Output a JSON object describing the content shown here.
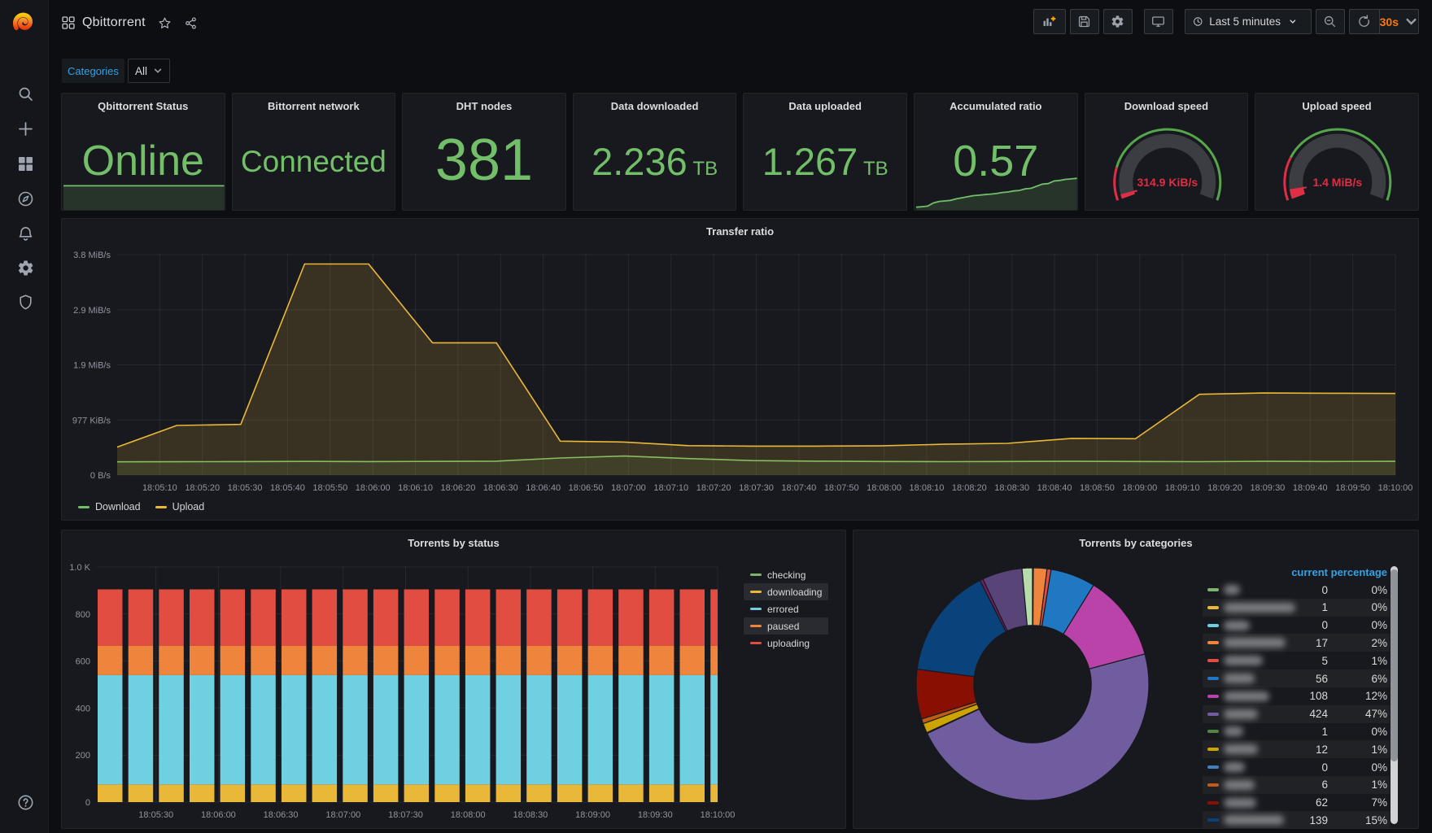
{
  "header": {
    "title": "Qbittorrent",
    "toolbar": {
      "time_range": "Last 5 minutes",
      "refresh_interval": "30s"
    }
  },
  "variables": {
    "label": "Categories",
    "value": "All"
  },
  "sidebar": {
    "icons": [
      "search-icon",
      "plus-icon",
      "dashboards-icon",
      "explore-compass-icon",
      "alerting-bell-icon",
      "configuration-gear-icon",
      "server-admin-shield-icon"
    ],
    "bottom_icons": [
      "help-icon"
    ]
  },
  "chart_data": [
    {
      "id": "stats",
      "type": "stat-row",
      "panels": [
        {
          "title": "Qbittorrent Status",
          "value": "Online",
          "color": "#73BF69",
          "font": 52,
          "sparkline": {
            "values": [
              1,
              1
            ],
            "max": 1.45
          }
        },
        {
          "title": "Bittorrent network",
          "value": "Connected",
          "color": "#73BF69",
          "font": 37
        },
        {
          "title": "DHT nodes",
          "value": "381",
          "color": "#73BF69",
          "font": 72
        },
        {
          "title": "Data downloaded",
          "value": "2.236",
          "unit": "TB",
          "color": "#73BF69",
          "font": 47
        },
        {
          "title": "Data uploaded",
          "value": "1.267",
          "unit": "TB",
          "color": "#73BF69",
          "font": 47
        },
        {
          "title": "Accumulated ratio",
          "value": "0.57",
          "color": "#73BF69",
          "font": 54,
          "sparkline": {
            "values": [
              0.02,
              0.03,
              0.04,
              0.1,
              0.13,
              0.14,
              0.15,
              0.18,
              0.2,
              0.22,
              0.24,
              0.25,
              0.26,
              0.27,
              0.28,
              0.3,
              0.31,
              0.33,
              0.34,
              0.37,
              0.38,
              0.42,
              0.46,
              0.47,
              0.52,
              0.53,
              0.55,
              0.56,
              0.57
            ],
            "max": 0.62
          }
        }
      ]
    },
    {
      "id": "gauges",
      "type": "gauge-row",
      "panels": [
        {
          "title": "Download speed",
          "value": "314.9 KiB/s",
          "fraction": 0.02,
          "threshold_red": 0.165
        },
        {
          "title": "Upload speed",
          "value": "1.4 MiB/s",
          "fraction": 0.048,
          "threshold_red": 0.218
        }
      ],
      "colors": {
        "green": "#56A64B",
        "red": "#E02F44",
        "track": "#3b3d42",
        "text": "#e8384f"
      }
    },
    {
      "id": "transfer",
      "type": "line",
      "title": "Transfer ratio",
      "xlabel": "",
      "ylabel": "",
      "x_range_seconds": [
        0,
        300
      ],
      "x_ticks": [
        {
          "t": 10,
          "label": "18:05:10"
        },
        {
          "t": 20,
          "label": "18:05:20"
        },
        {
          "t": 30,
          "label": "18:05:30"
        },
        {
          "t": 40,
          "label": "18:05:40"
        },
        {
          "t": 50,
          "label": "18:05:50"
        },
        {
          "t": 60,
          "label": "18:06:00"
        },
        {
          "t": 70,
          "label": "18:06:10"
        },
        {
          "t": 80,
          "label": "18:06:20"
        },
        {
          "t": 90,
          "label": "18:06:30"
        },
        {
          "t": 100,
          "label": "18:06:40"
        },
        {
          "t": 110,
          "label": "18:06:50"
        },
        {
          "t": 120,
          "label": "18:07:00"
        },
        {
          "t": 130,
          "label": "18:07:10"
        },
        {
          "t": 140,
          "label": "18:07:20"
        },
        {
          "t": 150,
          "label": "18:07:30"
        },
        {
          "t": 160,
          "label": "18:07:40"
        },
        {
          "t": 170,
          "label": "18:07:50"
        },
        {
          "t": 180,
          "label": "18:08:00"
        },
        {
          "t": 190,
          "label": "18:08:10"
        },
        {
          "t": 200,
          "label": "18:08:20"
        },
        {
          "t": 210,
          "label": "18:08:30"
        },
        {
          "t": 220,
          "label": "18:08:40"
        },
        {
          "t": 230,
          "label": "18:08:50"
        },
        {
          "t": 240,
          "label": "18:09:00"
        },
        {
          "t": 250,
          "label": "18:09:10"
        },
        {
          "t": 260,
          "label": "18:09:20"
        },
        {
          "t": 270,
          "label": "18:09:30"
        },
        {
          "t": 280,
          "label": "18:09:40"
        },
        {
          "t": 290,
          "label": "18:09:50"
        },
        {
          "t": 300,
          "label": "18:10:00"
        }
      ],
      "y_max": 4000000,
      "y_ticks": [
        {
          "v": 0,
          "label": "0 B/s"
        },
        {
          "v": 1000000,
          "label": "977 KiB/s"
        },
        {
          "v": 2000000,
          "label": "1.9 MiB/s"
        },
        {
          "v": 3000000,
          "label": "2.9 MiB/s"
        },
        {
          "v": 4000000,
          "label": "3.8 MiB/s"
        }
      ],
      "series": [
        {
          "name": "Download",
          "color": "#73BF69",
          "fill_opacity": 0.1,
          "points": [
            [
              -1,
              240000
            ],
            [
              14,
              242000
            ],
            [
              29,
              245000
            ],
            [
              44,
              248000
            ],
            [
              59,
              245000
            ],
            [
              74,
              248000
            ],
            [
              89,
              252000
            ],
            [
              104,
              310000
            ],
            [
              119,
              345000
            ],
            [
              134,
              300000
            ],
            [
              149,
              262000
            ],
            [
              164,
              252000
            ],
            [
              179,
              246000
            ],
            [
              194,
              244000
            ],
            [
              209,
              247000
            ],
            [
              224,
              250000
            ],
            [
              239,
              246000
            ],
            [
              254,
              244000
            ],
            [
              269,
              250000
            ],
            [
              284,
              247000
            ],
            [
              301,
              250000
            ]
          ]
        },
        {
          "name": "Upload",
          "color": "#EAB839",
          "fill_opacity": 0.16,
          "points": [
            [
              -1,
              480000
            ],
            [
              14,
              900000
            ],
            [
              29,
              920000
            ],
            [
              44,
              3830000
            ],
            [
              59,
              3830000
            ],
            [
              74,
              2400000
            ],
            [
              89,
              2400000
            ],
            [
              104,
              615000
            ],
            [
              119,
              600000
            ],
            [
              134,
              535000
            ],
            [
              149,
              525000
            ],
            [
              164,
              525000
            ],
            [
              179,
              530000
            ],
            [
              194,
              560000
            ],
            [
              209,
              575000
            ],
            [
              224,
              665000
            ],
            [
              239,
              660000
            ],
            [
              254,
              1465000
            ],
            [
              269,
              1490000
            ],
            [
              284,
              1485000
            ],
            [
              301,
              1480000
            ]
          ]
        }
      ],
      "legend": [
        {
          "name": "Download",
          "color": "#73BF69"
        },
        {
          "name": "Upload",
          "color": "#EAB839"
        }
      ]
    },
    {
      "id": "status",
      "type": "bar",
      "title": "Torrents by status",
      "categories_note": "20 bars at 15s intervals, constant values",
      "bar_count": 20,
      "ymax": 1000,
      "y_ticks": [
        {
          "v": 0,
          "label": "0"
        },
        {
          "v": 200,
          "label": "200"
        },
        {
          "v": 400,
          "label": "400"
        },
        {
          "v": 600,
          "label": "600"
        },
        {
          "v": 800,
          "label": "800"
        },
        {
          "v": 1000,
          "label": "1.0 K"
        }
      ],
      "x_labels": [
        "18:05:30",
        "18:06:00",
        "18:06:30",
        "18:07:00",
        "18:07:30",
        "18:08:00",
        "18:08:30",
        "18:09:00",
        "18:09:30",
        "18:10:00"
      ],
      "stack": [
        {
          "name": "downloading",
          "color": "#EAB839",
          "value": 75
        },
        {
          "name": "errored",
          "color": "#6ED0E0",
          "value": 465
        },
        {
          "name": "paused",
          "color": "#EF843C",
          "value": 125
        },
        {
          "name": "uploading",
          "color": "#E24D42",
          "value": 240
        }
      ],
      "legend": [
        {
          "name": "checking",
          "color": "#7EB26D",
          "highlight": false
        },
        {
          "name": "downloading",
          "color": "#EAB839",
          "highlight": true
        },
        {
          "name": "errored",
          "color": "#6ED0E0",
          "highlight": false
        },
        {
          "name": "paused",
          "color": "#EF843C",
          "highlight": true
        },
        {
          "name": "uploading",
          "color": "#E24D42",
          "highlight": false
        }
      ]
    },
    {
      "id": "categories",
      "type": "pie",
      "title": "Torrents by categories",
      "columns": [
        "current",
        "percentage"
      ],
      "donut_hole_ratio": 0.505,
      "rows": [
        {
          "color": "#7EB26D",
          "value": 0,
          "current": "0",
          "percentage": "0%",
          "blur_width": 20
        },
        {
          "color": "#EAB839",
          "value": 1,
          "current": "1",
          "percentage": "0%",
          "blur_width": 88
        },
        {
          "color": "#6ED0E0",
          "value": 0,
          "current": "0",
          "percentage": "0%",
          "blur_width": 32
        },
        {
          "color": "#EF843C",
          "value": 17,
          "current": "17",
          "percentage": "2%",
          "blur_width": 76
        },
        {
          "color": "#E24D42",
          "value": 5,
          "current": "5",
          "percentage": "1%",
          "blur_width": 48
        },
        {
          "color": "#1F78C1",
          "value": 56,
          "current": "56",
          "percentage": "6%",
          "blur_width": 38
        },
        {
          "color": "#BA43A9",
          "value": 108,
          "current": "108",
          "percentage": "12%",
          "blur_width": 56
        },
        {
          "color": "#705DA0",
          "value": 424,
          "current": "424",
          "percentage": "47%",
          "blur_width": 42
        },
        {
          "color": "#508642",
          "value": 1,
          "current": "1",
          "percentage": "0%",
          "blur_width": 24
        },
        {
          "color": "#CCA300",
          "value": 12,
          "current": "12",
          "percentage": "1%",
          "blur_width": 42
        },
        {
          "color": "#447EBC",
          "value": 0,
          "current": "0",
          "percentage": "0%",
          "blur_width": 26
        },
        {
          "color": "#C15C17",
          "value": 6,
          "current": "6",
          "percentage": "1%",
          "blur_width": 38
        },
        {
          "color": "#890F02",
          "value": 62,
          "current": "62",
          "percentage": "7%",
          "blur_width": 40
        },
        {
          "color": "#0A437C",
          "value": 139,
          "current": "139",
          "percentage": "15%",
          "blur_width": 74
        }
      ],
      "extra_slices": [
        {
          "color": "#6D1F62",
          "value": 4
        },
        {
          "color": "#584477",
          "value": 50
        },
        {
          "color": "#B7DBAB",
          "value": 13
        }
      ]
    }
  ]
}
